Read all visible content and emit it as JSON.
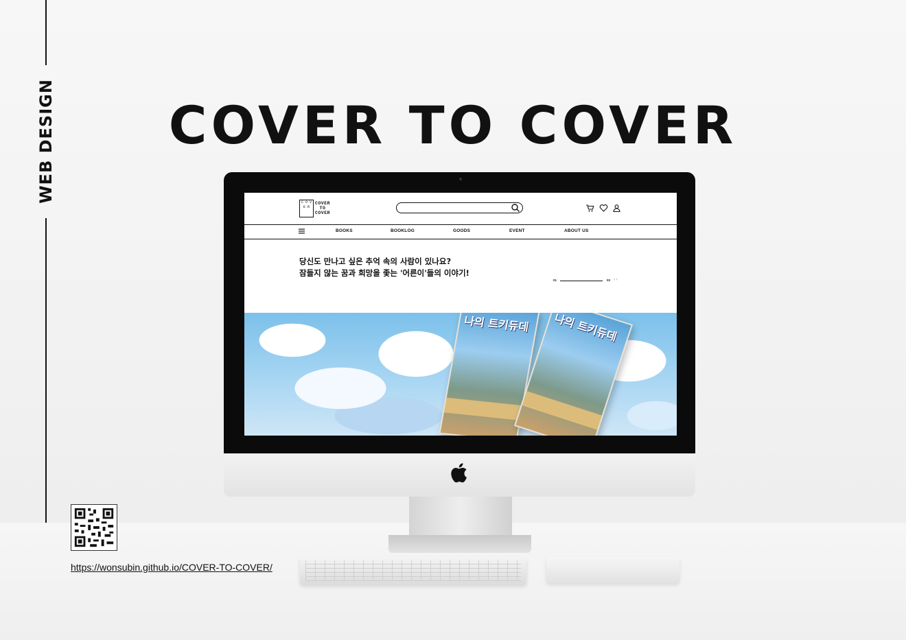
{
  "side_label": "WEB DESIGN",
  "main_title": "COVER TO COVER",
  "site": {
    "logo": {
      "box_text": "C O V E R",
      "text_line1": "COVER",
      "text_line2": "TO",
      "text_line3": "COVER"
    },
    "search": {
      "placeholder": ""
    },
    "header_icons": [
      "cart-icon",
      "heart-icon",
      "user-icon"
    ],
    "nav": {
      "items": [
        "BOOKS",
        "BOOKLOG",
        "GOODS",
        "EVENT",
        "ABOUT US"
      ]
    },
    "hero": {
      "line1": "당신도 만나고 싶은 추억 속의 사람이 있나요?",
      "line2": "잠들지 않는 꿈과 희망을 좇는 '어른이'들의 이야기!",
      "pager_current": "01",
      "pager_total": "03",
      "book_title": "나의 트키듀데"
    }
  },
  "url": "https://wonsubin.github.io/COVER-TO-COVER/",
  "colors": {
    "accent": "#111111",
    "sky": "#7cc0ea"
  }
}
